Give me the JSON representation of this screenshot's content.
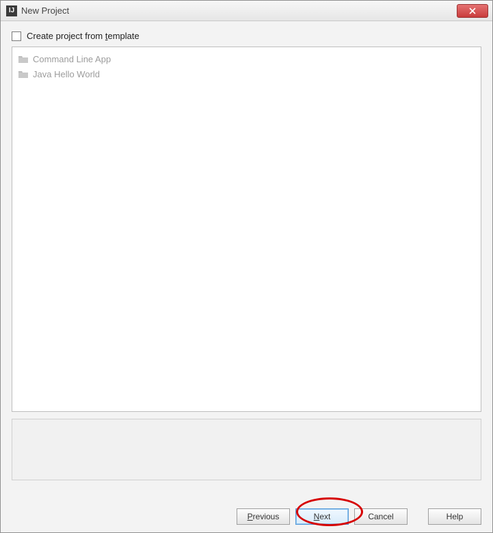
{
  "window": {
    "title": "New Project"
  },
  "checkbox": {
    "label_pre": "Create project from ",
    "mnemonic": "t",
    "label_post": "emplate",
    "checked": false
  },
  "templates": [
    {
      "label": "Command Line App"
    },
    {
      "label": "Java Hello World"
    }
  ],
  "buttons": {
    "previous_m": "P",
    "previous_rest": "revious",
    "next_m": "N",
    "next_rest": "ext",
    "cancel": "Cancel",
    "help": "Help"
  }
}
